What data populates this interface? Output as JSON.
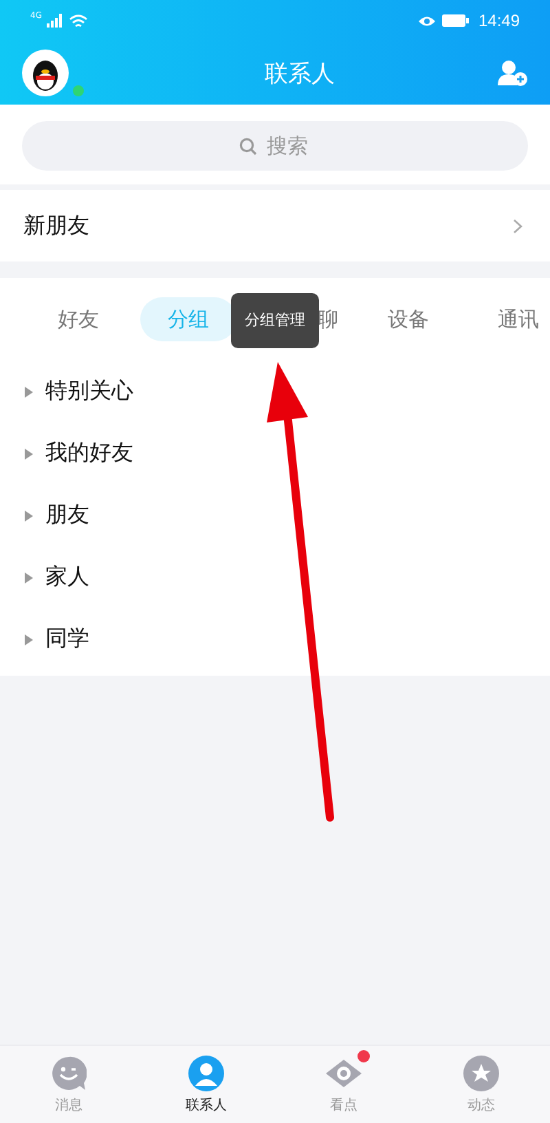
{
  "status_bar": {
    "time": "14:49",
    "network": "4G"
  },
  "header": {
    "title": "联系人",
    "online": true
  },
  "search": {
    "placeholder": "搜索"
  },
  "new_friends": {
    "label": "新朋友"
  },
  "tabs": [
    {
      "label": "好友",
      "selected": false
    },
    {
      "label": "分组",
      "selected": true
    },
    {
      "label": "聊",
      "selected": false
    },
    {
      "label": "设备",
      "selected": false
    },
    {
      "label": "通讯",
      "selected": false
    }
  ],
  "tooltip": {
    "text": "分组管理"
  },
  "groups": [
    {
      "name": "特别关心",
      "expanded": false
    },
    {
      "name": "我的好友",
      "expanded": false
    },
    {
      "name": "朋友",
      "expanded": false
    },
    {
      "name": "家人",
      "expanded": false
    },
    {
      "name": "同学",
      "expanded": false
    }
  ],
  "bottom_nav": [
    {
      "label": "消息",
      "kind": "chat",
      "selected": false,
      "badge": false
    },
    {
      "label": "联系人",
      "kind": "person",
      "selected": true,
      "badge": false
    },
    {
      "label": "看点",
      "kind": "eye",
      "selected": false,
      "badge": true
    },
    {
      "label": "动态",
      "kind": "star",
      "selected": false,
      "badge": false
    }
  ]
}
